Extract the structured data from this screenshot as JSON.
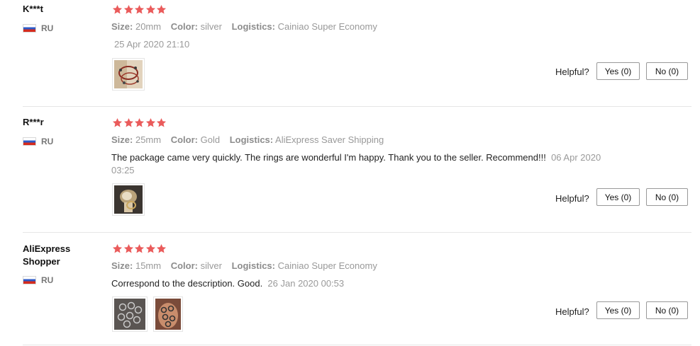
{
  "reviews": [
    {
      "user": "K***t",
      "country": "RU",
      "rating": 5,
      "attributes": [
        {
          "label": "Size:",
          "value": "20mm"
        },
        {
          "label": "Color:",
          "value": "silver"
        },
        {
          "label": "Logistics:",
          "value": "Cainiao Super Economy"
        }
      ],
      "text": "",
      "date": "25 Apr 2020 21:10",
      "helpful_label": "Helpful?",
      "yes_label": "Yes (0)",
      "no_label": "No (0)"
    },
    {
      "user": "R***r",
      "country": "RU",
      "rating": 5,
      "attributes": [
        {
          "label": "Size:",
          "value": "25mm"
        },
        {
          "label": "Color:",
          "value": "Gold"
        },
        {
          "label": "Logistics:",
          "value": "AliExpress Saver Shipping"
        }
      ],
      "text": "The package came very quickly. The rings are wonderful I'm happy. Thank you to the seller. Recommend!!!",
      "date": "06 Apr 2020 03:25",
      "helpful_label": "Helpful?",
      "yes_label": "Yes (0)",
      "no_label": "No (0)"
    },
    {
      "user": "AliExpress Shopper",
      "country": "RU",
      "rating": 5,
      "attributes": [
        {
          "label": "Size:",
          "value": "15mm"
        },
        {
          "label": "Color:",
          "value": "silver"
        },
        {
          "label": "Logistics:",
          "value": "Cainiao Super Economy"
        }
      ],
      "text": "Correspond to the description. Good.",
      "date": "26 Jan 2020 00:53",
      "helpful_label": "Helpful?",
      "yes_label": "Yes (0)",
      "no_label": "No (0)"
    }
  ],
  "colors": {
    "star": "#ea5b5b",
    "divider": "#e6e6e6"
  },
  "icons": {
    "star": "star-icon",
    "flag": "ru-flag-icon"
  }
}
